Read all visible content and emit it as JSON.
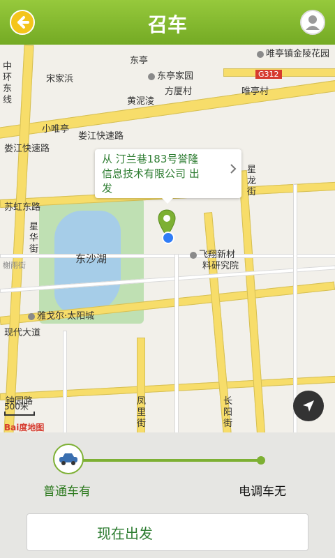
{
  "header": {
    "title": "召车"
  },
  "map": {
    "callout_lines": [
      "从 汀兰巷183号誉隆",
      "信息技术有限公司 出",
      "发"
    ],
    "labels": {
      "songjiabang": "宋家浜",
      "huayuan": "东亭家园",
      "fangxiacun": "方厦村",
      "huangniluo": "黄泥淩",
      "xiaoweiting": "小唯亭",
      "weitingcun": "唯亭村",
      "loujiang1": "娄江快速路",
      "loujiang2": "娄江快速路",
      "suhong": "苏虹东路",
      "dongshahu": "东沙湖",
      "feixiang_a": "飞翔新材",
      "feixiang_b": "料研究院",
      "yageer": "雅戈尔·太阳城",
      "xiandai": "现代大道",
      "zhonghuan_a": "中",
      "zhonghuan_b": "环",
      "zhonghuan_c": "东",
      "zhonghuan_d": "线",
      "xinglong_a": "星",
      "xinglong_b": "龙",
      "xinglong_c": "街",
      "xinghua_a": "星",
      "xinghua_b": "华",
      "xinghua_c": "街",
      "fengli_a": "凤",
      "fengli_b": "里",
      "fengli_c": "街",
      "changyang_a": "长",
      "changyang_b": "阳",
      "changyang_c": "街",
      "zhongyuan": "钟园路",
      "weiting_hotel": "唯亭镇金陵花园",
      "g312": "G312",
      "dongting": "东亭",
      "xiyu": "榭雨街"
    },
    "scale": "500米",
    "logo": "Bai度地图"
  },
  "panel": {
    "left_option": "普通车有",
    "right_option": "电调车无",
    "action_label": "现在出发"
  }
}
